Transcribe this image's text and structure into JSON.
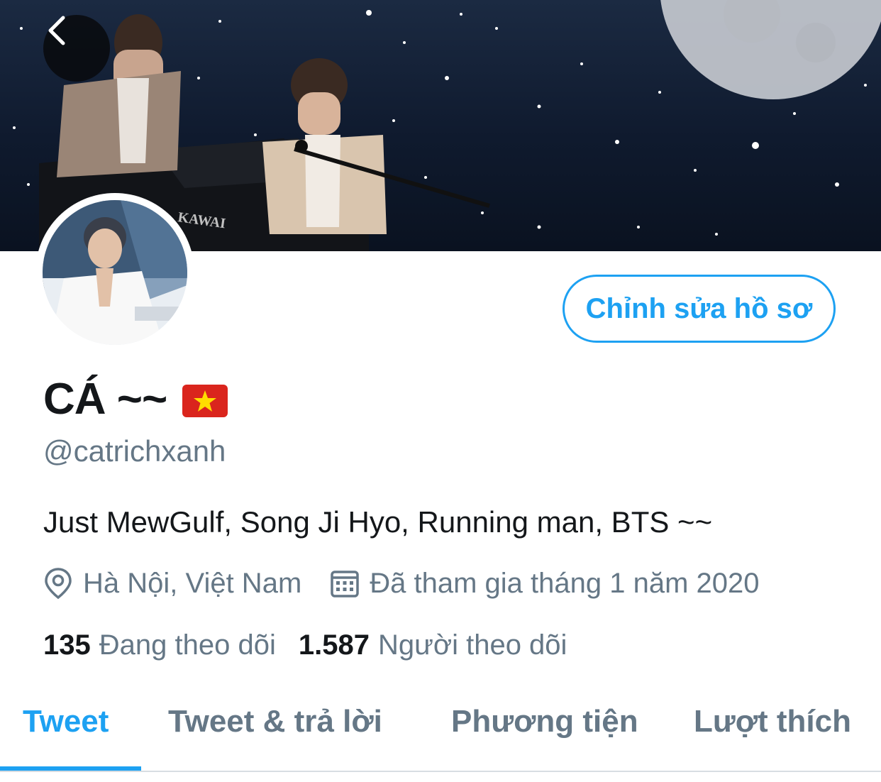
{
  "header": {
    "back_icon": "chevron-left-icon",
    "banner_text": "KAWAI"
  },
  "profile": {
    "edit_button_label": "Chỉnh sửa hồ sơ",
    "display_name": "CÁ ~~",
    "flag_icon": "vietnam-flag-icon",
    "handle": "@catrichxanh",
    "bio": "Just MewGulf, Song Ji Hyo, Running man, BTS ~~",
    "location": "Hà Nội, Việt Nam",
    "joined": "Đã tham gia tháng 1 năm 2020",
    "following_count": "135",
    "following_label": "Đang theo dõi",
    "followers_count": "1.587",
    "followers_label": "Người theo dõi"
  },
  "tabs": [
    {
      "label": "Tweet",
      "active": true
    },
    {
      "label": "Tweet & trả lời",
      "active": false
    },
    {
      "label": "Phương tiện",
      "active": false
    },
    {
      "label": "Lượt thích",
      "active": false
    }
  ],
  "colors": {
    "accent": "#1da1f2",
    "text_primary": "#14171a",
    "text_secondary": "#657786",
    "flag_red": "#da251d",
    "flag_star": "#ffde00"
  }
}
